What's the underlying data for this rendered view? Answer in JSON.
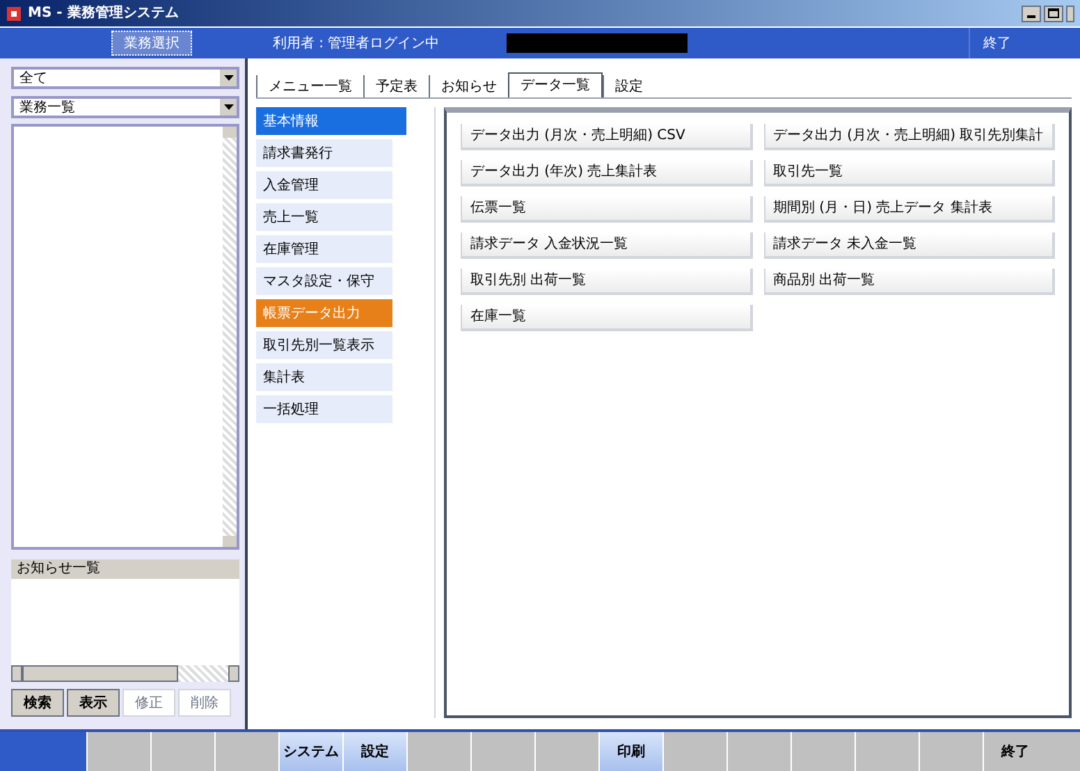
{
  "window": {
    "title": "MS - 業務管理システム"
  },
  "header": {
    "items": [
      {
        "label": "業務選択",
        "selected": true
      },
      {
        "label": "利用者 : 管理者ログイン中",
        "selected": false
      }
    ],
    "user": "終了"
  },
  "left": {
    "dropdowns": [
      "全て",
      "業務一覧"
    ],
    "list_label": "お知らせ一覧",
    "tabs": [
      {
        "label": "検索",
        "selected": false
      },
      {
        "label": "表示",
        "selected": false
      },
      {
        "label": "修正",
        "selected": true
      },
      {
        "label": "削除",
        "selected": true
      }
    ]
  },
  "main_tabs": [
    {
      "label": "メニュー一覧",
      "selected": false
    },
    {
      "label": "予定表",
      "selected": false
    },
    {
      "label": "お知らせ",
      "selected": false
    },
    {
      "label": "データ一覧",
      "selected": true
    },
    {
      "label": "設定",
      "selected": false
    }
  ],
  "menu": [
    {
      "label": "基本情報",
      "selected": true,
      "highlighted": false
    },
    {
      "label": "請求書発行",
      "selected": false,
      "highlighted": false
    },
    {
      "label": "入金管理",
      "selected": false,
      "highlighted": false
    },
    {
      "label": "売上一覧",
      "selected": false,
      "highlighted": false
    },
    {
      "label": "在庫管理",
      "selected": false,
      "highlighted": false
    },
    {
      "label": "マスタ設定・保守",
      "selected": false,
      "highlighted": false
    },
    {
      "label": "帳票データ出力",
      "selected": false,
      "highlighted": true
    },
    {
      "label": "取引先別一覧表示",
      "selected": false,
      "highlighted": false
    },
    {
      "label": "集計表",
      "selected": false,
      "highlighted": false
    },
    {
      "label": "一括処理",
      "selected": false,
      "highlighted": false
    }
  ],
  "buttons": [
    "データ出力 (月次・売上明細) CSV",
    "データ出力 (月次・売上明細) 取引先別集計",
    "データ出力 (年次) 売上集計表",
    "取引先一覧",
    "伝票一覧",
    "期間別 (月・日) 売上データ 集計表",
    "請求データ 入金状況一覧",
    "請求データ 未入金一覧",
    "取引先別 出荷一覧",
    "商品別 出荷一覧",
    "在庫一覧"
  ],
  "taskbar": [
    {
      "active": false
    },
    {
      "active": false
    },
    {
      "active": false
    },
    {
      "label": "システム",
      "active": true
    },
    {
      "label": "設定",
      "active": true
    },
    {
      "active": false
    },
    {
      "active": false
    },
    {
      "active": false
    },
    {
      "label": "印刷",
      "active": true
    },
    {
      "active": false
    },
    {
      "active": false
    },
    {
      "active": false
    },
    {
      "active": false
    },
    {
      "active": false
    },
    {
      "label": "終了",
      "active": false
    }
  ]
}
